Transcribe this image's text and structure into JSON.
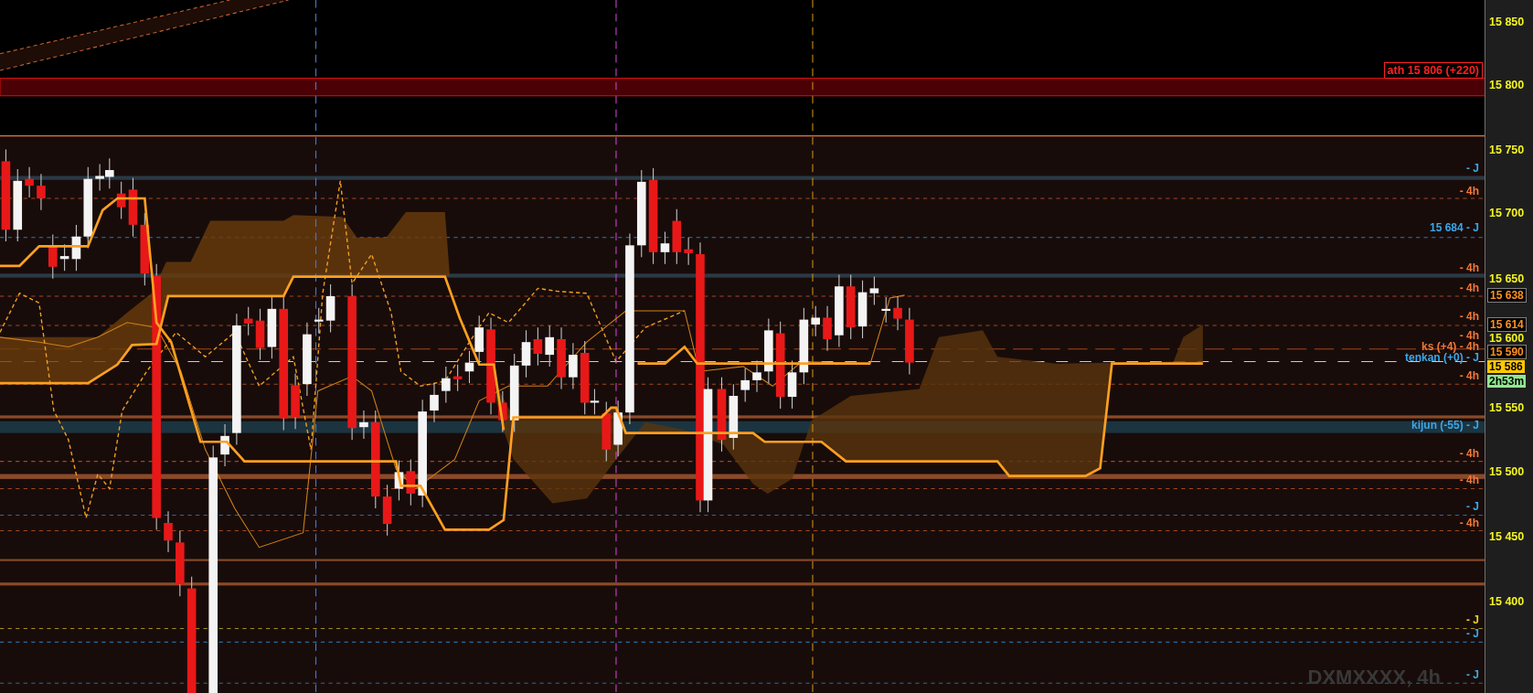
{
  "chart": {
    "title": "DXMXXXX, 4h",
    "ath_label": "ath 15 806 (+220)",
    "levels": [
      {
        "label": "- J",
        "color": "#3aa8e8"
      },
      {
        "label": "- 4h",
        "color": "#f07838"
      },
      {
        "label": "15 684 - J",
        "color": "#3aa8e8"
      },
      {
        "label": "- 4h",
        "color": "#f07838"
      },
      {
        "label": "- 4h",
        "color": "#f07838"
      },
      {
        "label": "- 4h",
        "color": "#f07838"
      },
      {
        "label": "- 4h",
        "color": "#f07838"
      },
      {
        "label": "ks (+4) - 4h",
        "color": "#f07838"
      },
      {
        "label": "tenkan (+0) - J",
        "color": "#3aa8e8"
      },
      {
        "label": "- 4h",
        "color": "#f07838"
      },
      {
        "label": "kijun (-55) - J",
        "color": "#3aa8e8"
      },
      {
        "label": "- 4h",
        "color": "#f07838"
      },
      {
        "label": "- 4h",
        "color": "#f07838"
      },
      {
        "label": "- J",
        "color": "#3aa8e8"
      },
      {
        "label": "- 4h",
        "color": "#f07838"
      },
      {
        "label": "- J",
        "color": "#e8d020"
      },
      {
        "label": "- J",
        "color": "#3aa8e8"
      },
      {
        "label": "- J",
        "color": "#3aa8e8"
      }
    ],
    "axis_ticks": [
      "15 850",
      "15 800",
      "15 750",
      "15 700",
      "15 650",
      "15 600",
      "15 550",
      "15 500",
      "15 450",
      "15 400"
    ],
    "price_tags": [
      {
        "text": "15 638",
        "kind": "level"
      },
      {
        "text": "15 614",
        "kind": "level"
      },
      {
        "text": "15 590",
        "kind": "level"
      },
      {
        "text": "15 586",
        "kind": "last"
      },
      {
        "text": "2h53m",
        "kind": "timer"
      }
    ]
  }
}
